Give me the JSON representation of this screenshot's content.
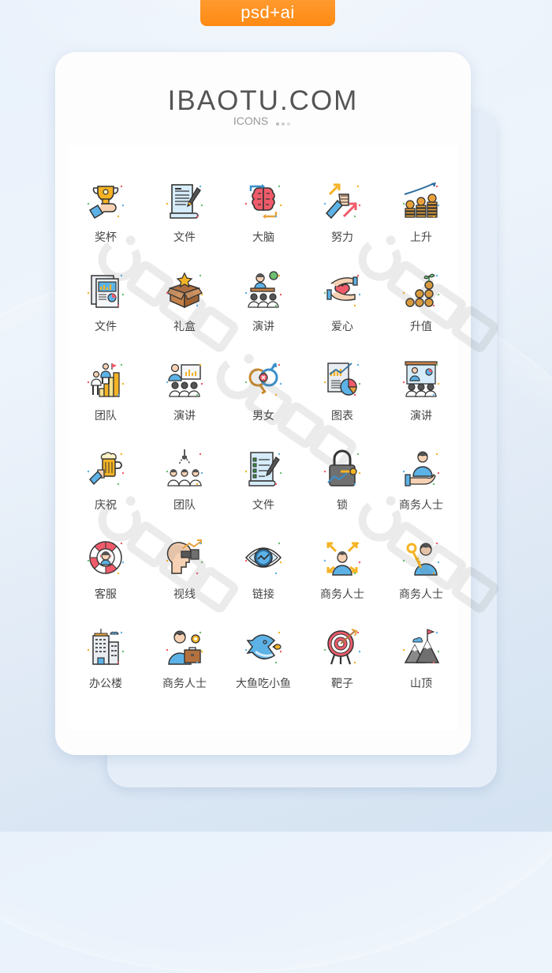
{
  "badge": "psd+ai",
  "brand": {
    "title": "IBAOTU.COM",
    "subtitle": "ICONS",
    "dot_colors": [
      "#bbbbbb",
      "#cccccc",
      "#dddddd"
    ]
  },
  "colors": {
    "accent_orange": "#ff8a14",
    "brand_text": "#555555",
    "label_text": "#444444"
  },
  "watermark": "包图网",
  "icons": [
    {
      "label": "奖杯",
      "icon": "trophy-hand-icon"
    },
    {
      "label": "文件",
      "icon": "document-pen-icon"
    },
    {
      "label": "大脑",
      "icon": "brain-arrows-icon"
    },
    {
      "label": "努力",
      "icon": "fist-arrows-icon"
    },
    {
      "label": "上升",
      "icon": "coins-growth-icon"
    },
    {
      "label": "文件",
      "icon": "report-chart-icon"
    },
    {
      "label": "礼盒",
      "icon": "gift-box-star-icon"
    },
    {
      "label": "演讲",
      "icon": "speaker-audience-icon"
    },
    {
      "label": "爱心",
      "icon": "hands-heart-icon"
    },
    {
      "label": "升值",
      "icon": "coin-plant-icon"
    },
    {
      "label": "团队",
      "icon": "team-podium-icon"
    },
    {
      "label": "演讲",
      "icon": "presenter-chart-icon"
    },
    {
      "label": "男女",
      "icon": "gender-symbols-icon"
    },
    {
      "label": "图表",
      "icon": "chart-pie-icon"
    },
    {
      "label": "演讲",
      "icon": "presentation-board-icon"
    },
    {
      "label": "庆祝",
      "icon": "beer-mug-icon"
    },
    {
      "label": "团队",
      "icon": "team-claw-icon"
    },
    {
      "label": "文件",
      "icon": "checklist-pen-icon"
    },
    {
      "label": "锁",
      "icon": "padlock-key-icon"
    },
    {
      "label": "商务人士",
      "icon": "businessman-hand-icon"
    },
    {
      "label": "客服",
      "icon": "lifebuoy-support-icon"
    },
    {
      "label": "视线",
      "icon": "head-binoculars-icon"
    },
    {
      "label": "链接",
      "icon": "eye-graph-icon"
    },
    {
      "label": "商务人士",
      "icon": "businessman-arrows-icon"
    },
    {
      "label": "商务人士",
      "icon": "businessman-key-icon"
    },
    {
      "label": "办公楼",
      "icon": "office-building-icon"
    },
    {
      "label": "商务人士",
      "icon": "businessman-briefcase-icon"
    },
    {
      "label": "大鱼吃小鱼",
      "icon": "big-fish-small-fish-icon"
    },
    {
      "label": "靶子",
      "icon": "target-arrow-icon"
    },
    {
      "label": "山顶",
      "icon": "mountain-flag-icon"
    }
  ]
}
